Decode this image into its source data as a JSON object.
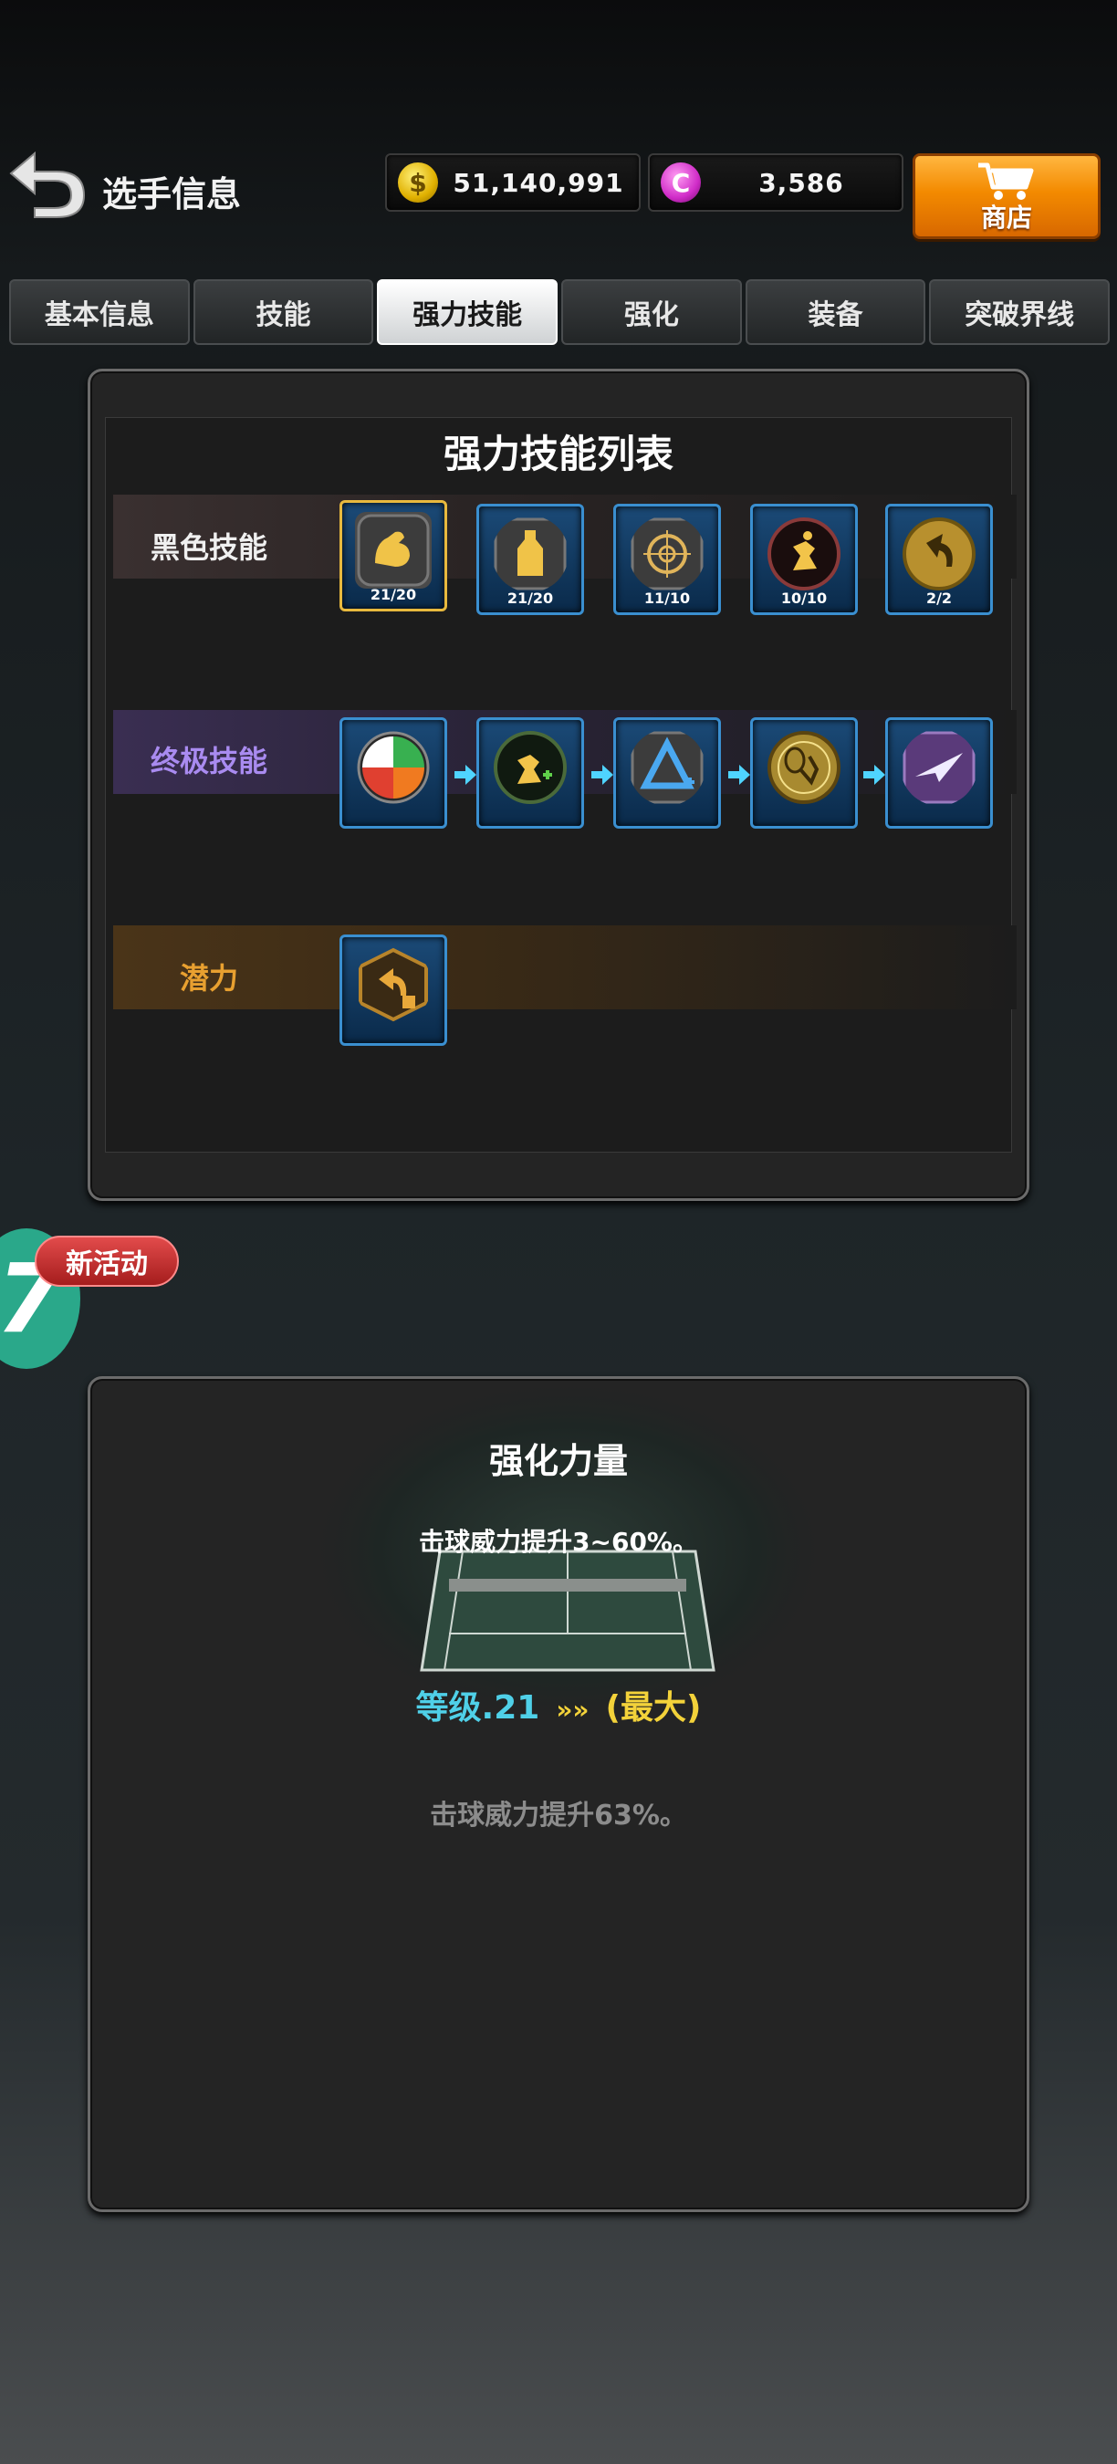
{
  "header": {
    "title": "选手信息",
    "gold": "51,140,991",
    "gems": "3,586",
    "gold_symbol": "$",
    "gem_symbol": "C",
    "shop_label": "商店"
  },
  "tabs": [
    {
      "label": "基本信息",
      "active": false
    },
    {
      "label": "技能",
      "active": false
    },
    {
      "label": "强力技能",
      "active": true
    },
    {
      "label": "强化",
      "active": false
    },
    {
      "label": "装备",
      "active": false
    },
    {
      "label": "突破界线",
      "active": false
    }
  ],
  "skill_list": {
    "title": "强力技能列表",
    "black_skills": {
      "label": "黑色技能",
      "items": [
        {
          "icon": "flexed-arm-icon",
          "count": "21/20",
          "selected": true
        },
        {
          "icon": "energy-bottle-icon",
          "count": "21/20",
          "selected": false
        },
        {
          "icon": "target-crosshair-icon",
          "count": "11/10",
          "selected": false
        },
        {
          "icon": "player-swing-icon",
          "count": "10/10",
          "selected": false
        },
        {
          "icon": "curved-arrow-icon",
          "count": "2/2",
          "selected": false
        }
      ]
    },
    "ultimate_skills": {
      "label": "终极技能",
      "items": [
        {
          "icon": "color-wheel-icon"
        },
        {
          "icon": "player-power-up-icon"
        },
        {
          "icon": "triangle-boost-icon"
        },
        {
          "icon": "racket-player-icon"
        },
        {
          "icon": "paper-plane-icon"
        }
      ]
    },
    "potential": {
      "label": "潜力",
      "items": [
        {
          "icon": "potential-arrow-icon"
        }
      ]
    }
  },
  "activity": {
    "badge": "新活动",
    "number": "7"
  },
  "detail": {
    "title": "强化力量",
    "description": "击球威力提升3~60%。",
    "level": "等级.21",
    "separator": "»»",
    "max_label": "(最大)",
    "effect": "击球威力提升63%。"
  }
}
